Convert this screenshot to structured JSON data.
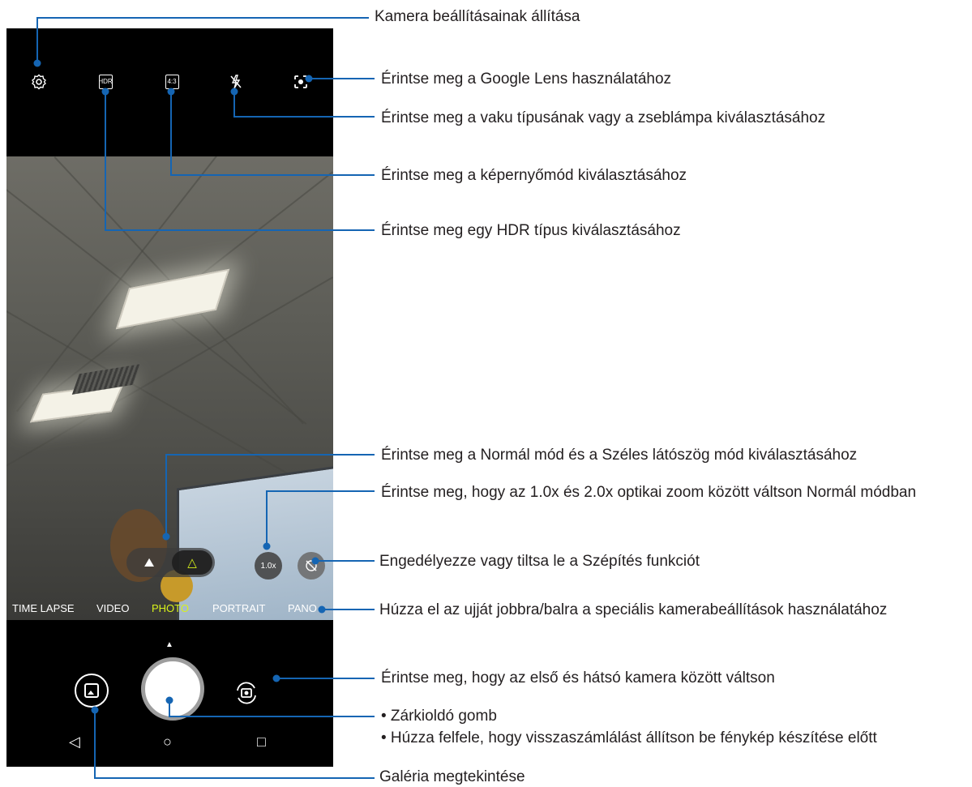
{
  "colors": {
    "leader_line": "#1565b3",
    "active_mode": "#d8f21a",
    "phone_background": "#000000",
    "callout_text": "#231f20"
  },
  "top_bar": {
    "settings_icon": "gear-icon",
    "hdr_icon": "hdr-icon",
    "hdr_label": "HDR",
    "aspect_icon": "aspect-ratio-icon",
    "aspect_label": "4:3",
    "flash_icon": "flash-off-icon",
    "lens_icon": "google-lens-icon"
  },
  "lens_selector": {
    "wide_icon": "wide-angle-icon",
    "normal_icon": "normal-lens-icon"
  },
  "zoom_label": "1.0x",
  "beauty_icon": "beauty-off-icon",
  "modes": [
    {
      "label": "TIME LAPSE",
      "active": false
    },
    {
      "label": "VIDEO",
      "active": false
    },
    {
      "label": "PHOTO",
      "active": true
    },
    {
      "label": "PORTRAIT",
      "active": false
    },
    {
      "label": "PANO",
      "active": false
    }
  ],
  "bottom_controls": {
    "gallery_icon": "gallery-icon",
    "shutter_label": "",
    "swipe_up_icon": "chevron-up-icon",
    "switch_camera_icon": "switch-camera-icon"
  },
  "nav_bar": {
    "back": "◁",
    "home": "○",
    "recents": "□"
  },
  "callouts": {
    "settings": "Kamera beállításainak állítása",
    "google_lens": "Érintse meg a Google Lens használatához",
    "flash": "Érintse meg a vaku típusának vagy a zseblámpa kiválasztásához",
    "screen_mode": "Érintse meg a képernyőmód kiválasztásához",
    "hdr": "Érintse meg egy HDR típus kiválasztásához",
    "lens_mode": "Érintse meg a Normál mód és a Széles látószög mód kiválasztásához",
    "zoom": "Érintse meg, hogy az 1.0x és 2.0x optikai zoom között váltson Normál módban",
    "beauty": "Engedélyezze vagy tiltsa le a Szépítés funkciót",
    "modes": "Húzza el az ujját jobbra/balra a speciális kamerabeállítások használatához",
    "switch_camera": "Érintse meg, hogy az első és hátsó kamera között váltson",
    "shutter_1": "• Zárkioldó gomb",
    "shutter_2": "• Húzza felfele, hogy visszaszámlálást állítson be fénykép készítése előtt",
    "gallery": "Galéria megtekintése"
  }
}
